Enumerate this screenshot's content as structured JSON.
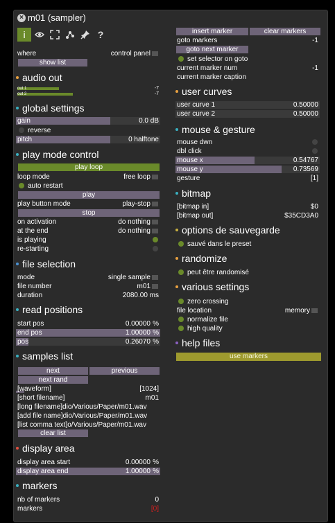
{
  "window": {
    "title": "m01 (sampler)",
    "close_glyph": "×"
  },
  "toolbar": [
    {
      "name": "info-icon",
      "glyph": "i",
      "active": true
    },
    {
      "name": "eye-icon",
      "glyph": "eye"
    },
    {
      "name": "resize-icon",
      "glyph": "resize"
    },
    {
      "name": "connect-icon",
      "glyph": "nodes"
    },
    {
      "name": "pin-icon",
      "glyph": "pin"
    },
    {
      "name": "help-icon",
      "glyph": "?"
    }
  ],
  "left": {
    "where": {
      "label": "where",
      "value": "control panel"
    },
    "show_list": "show list",
    "audio_out": {
      "title": "audio out",
      "bullet": "#e8a040",
      "meters": [
        {
          "label": "out 1",
          "value": "-7",
          "level": 0.45
        },
        {
          "label": "out 2",
          "value": "-7",
          "level": 0.6
        }
      ]
    },
    "global": {
      "title": "global settings",
      "bullet": "#3ab0c0",
      "gain": {
        "label": "gain",
        "value": "0.0 dB",
        "fill": 0.7
      },
      "reverse": "reverse",
      "pitch": {
        "label": "pitch",
        "value": "0 halftone"
      }
    },
    "play_mode": {
      "title": "play mode control",
      "bullet": "#3ab0c0",
      "play_loop": "play loop",
      "loop_mode": {
        "label": "loop mode",
        "value": "free loop"
      },
      "auto_restart": "auto restart",
      "play": "play",
      "play_button_mode": {
        "label": "play button mode",
        "value": "play-stop"
      },
      "stop": "stop",
      "on_activation": {
        "label": "on activation",
        "value": "do nothing"
      },
      "at_the_end": {
        "label": "at the end",
        "value": "do nothing"
      },
      "is_playing": "is playing",
      "re_starting": "re-starting"
    },
    "file_selection": {
      "title": "file selection",
      "bullet": "#4a90d0",
      "mode": {
        "label": "mode",
        "value": "single sample"
      },
      "file_number": {
        "label": "file number",
        "value": "m01"
      },
      "duration": {
        "label": "duration",
        "value": "2080.00 ms"
      }
    },
    "read_positions": {
      "title": "read positions",
      "bullet": "#3ab0c0",
      "start_pos": {
        "label": "start pos",
        "value": "0.00000",
        "unit": "%"
      },
      "end_pos": {
        "label": "end pos",
        "value": "1.00000",
        "unit": "%"
      },
      "pos": {
        "label": "pos",
        "value": "0.26070",
        "unit": "%",
        "fill": 0.26
      }
    },
    "samples_list": {
      "title": "samples list",
      "bullet": "#3ab0c0",
      "next": "next",
      "previous": "previous",
      "next_rand": "next rand",
      "waveform": {
        "label": "[waveform]",
        "value": "[1024]"
      },
      "short_filename": {
        "label": "[short filename]",
        "value": "m01"
      },
      "long_filename": "[long filename]dio/Various/Paper/m01.wav",
      "add_file_name": "[add file name]dio/Various/Paper/m01.wav",
      "list_comma_text": "[list comma text]o/Various/Paper/m01.wav",
      "clear_list": "clear list"
    },
    "display_area": {
      "title": "display area",
      "bullet": "#e05040",
      "start": {
        "label": "display area start",
        "value": "0.00000",
        "unit": "%"
      },
      "end": {
        "label": "display area end",
        "value": "1.00000",
        "unit": "%"
      }
    },
    "markers": {
      "title": "markers",
      "bullet": "#3ab0c0",
      "nb": {
        "label": "nb of markers",
        "value": "0"
      },
      "markers": {
        "label": "markers",
        "value": "[0]"
      }
    }
  },
  "right": {
    "insert_marker": "insert marker",
    "clear_markers": "clear markers",
    "goto_markers": {
      "label": "goto markers",
      "value": "-1"
    },
    "goto_next_marker": "goto next marker",
    "set_selector": "set selector on goto",
    "current_marker_num": {
      "label": "current marker num",
      "value": "-1"
    },
    "current_marker_caption": "current marker caption",
    "user_curves": {
      "title": "user curves",
      "bullet": "#e8a040",
      "c1": {
        "label": "user curve 1",
        "value": "0.50000"
      },
      "c2": {
        "label": "user curve 2",
        "value": "0.50000"
      }
    },
    "mouse": {
      "title": "mouse & gesture",
      "bullet": "#3ab0c0",
      "mouse_dwn": "mouse dwn",
      "dbl_click": "dbl click",
      "mouse_x": {
        "label": "mouse x",
        "value": "0.54767",
        "fill": 0.55
      },
      "mouse_y": {
        "label": "mouse y",
        "value": "0.73569",
        "fill": 0.74
      },
      "gesture": {
        "label": "gesture",
        "value": "[1]"
      }
    },
    "bitmap": {
      "title": "bitmap",
      "bullet": "#3ab0c0",
      "in": {
        "label": "[bitmap in]",
        "value": "$0"
      },
      "out": {
        "label": "[bitmap out]",
        "value": "$35CD3A0"
      }
    },
    "options": {
      "title": "options de sauvegarde",
      "bullet": "#c8b040",
      "saved": "sauvé dans le preset"
    },
    "randomize": {
      "title": "randomize",
      "bullet": "#e8a040",
      "randomised": "peut être randomisé"
    },
    "various": {
      "title": "various settings",
      "bullet": "#e8a040",
      "zero_crossing": "zero crossing",
      "file_location": {
        "label": "file location",
        "value": "memory"
      },
      "normalize": "normalize file",
      "high_quality": "high quality"
    },
    "help": {
      "title": "help files",
      "bullet": "#8a60c0",
      "use_markers": "use markers"
    }
  },
  "colors": {
    "accent_green": "#6a8a2a",
    "button_purple": "#6e6478",
    "yellow_button": "#9e9a2e",
    "value_red": "#d02020"
  }
}
